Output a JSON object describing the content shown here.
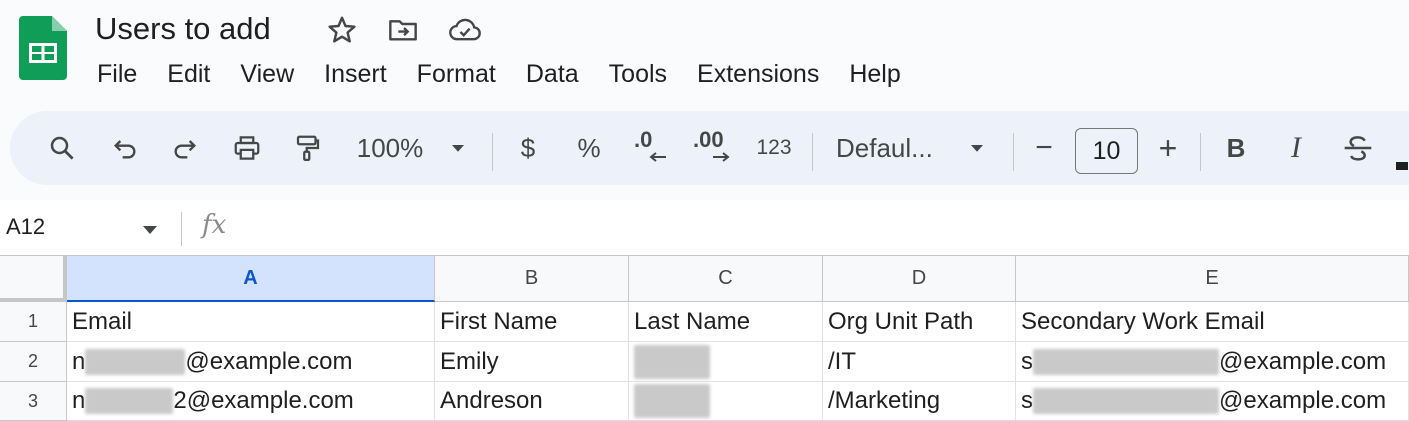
{
  "app": {
    "title": "Users to add",
    "brand_color": "#0f9d58"
  },
  "menu": [
    "File",
    "Edit",
    "View",
    "Insert",
    "Format",
    "Data",
    "Tools",
    "Extensions",
    "Help"
  ],
  "toolbar": {
    "zoom": "100%",
    "currency": "$",
    "percent": "%",
    "decrease_decimal": ".0",
    "increase_decimal": ".00",
    "number_format": "123",
    "font": "Defaul...",
    "font_size": "10",
    "decrease_size": "−",
    "increase_size": "+",
    "bold": "B",
    "italic": "I"
  },
  "formula_bar": {
    "name_box": "A12",
    "fx": "fx"
  },
  "grid": {
    "columns": [
      "A",
      "B",
      "C",
      "D",
      "E"
    ],
    "selected_column": "A",
    "rows": [
      {
        "num": "1",
        "cells": [
          "Email",
          "First Name",
          "Last Name",
          "Org Unit Path",
          "Secondary Work Email"
        ]
      },
      {
        "num": "2",
        "cells": [
          "n",
          "@example.com",
          "Emily",
          "",
          "/IT",
          "s",
          "@example.com"
        ]
      },
      {
        "num": "3",
        "cells": [
          "n",
          "2@example.com",
          "Andreson",
          "",
          "/Marketing",
          "s",
          "@example.com"
        ]
      }
    ]
  }
}
